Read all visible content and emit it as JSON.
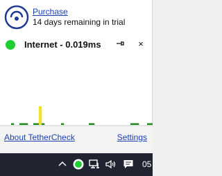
{
  "app": {
    "purchase_label": "Purchase",
    "trial_text": "14 days remaining in trial"
  },
  "status": {
    "label": "Internet - 0.019ms",
    "dot_color": "#22cc33",
    "pin_icon": "pin-icon",
    "close_label": "×"
  },
  "graph": {
    "bar_color": "#228b22",
    "spike_color": "#f2e02a",
    "ping_values": [
      0,
      0,
      0,
      0,
      1,
      0,
      0,
      1,
      1,
      1,
      0,
      0,
      1,
      1,
      8,
      1,
      0,
      0,
      0,
      0,
      0,
      0,
      1,
      0,
      0,
      0,
      0,
      0,
      0,
      0,
      0,
      0,
      1,
      1,
      0,
      0,
      0,
      0,
      0,
      0,
      0,
      0,
      0,
      0,
      0,
      0,
      0,
      1,
      1,
      1,
      0,
      0,
      0,
      1,
      1
    ]
  },
  "footer": {
    "about_label": "About TetherCheck",
    "settings_label": "Settings"
  },
  "taskbar": {
    "clock": "05",
    "icons": [
      "chevron-up-icon",
      "tethercheck-tray-icon",
      "network-icon",
      "volume-icon",
      "action-center-icon"
    ]
  }
}
